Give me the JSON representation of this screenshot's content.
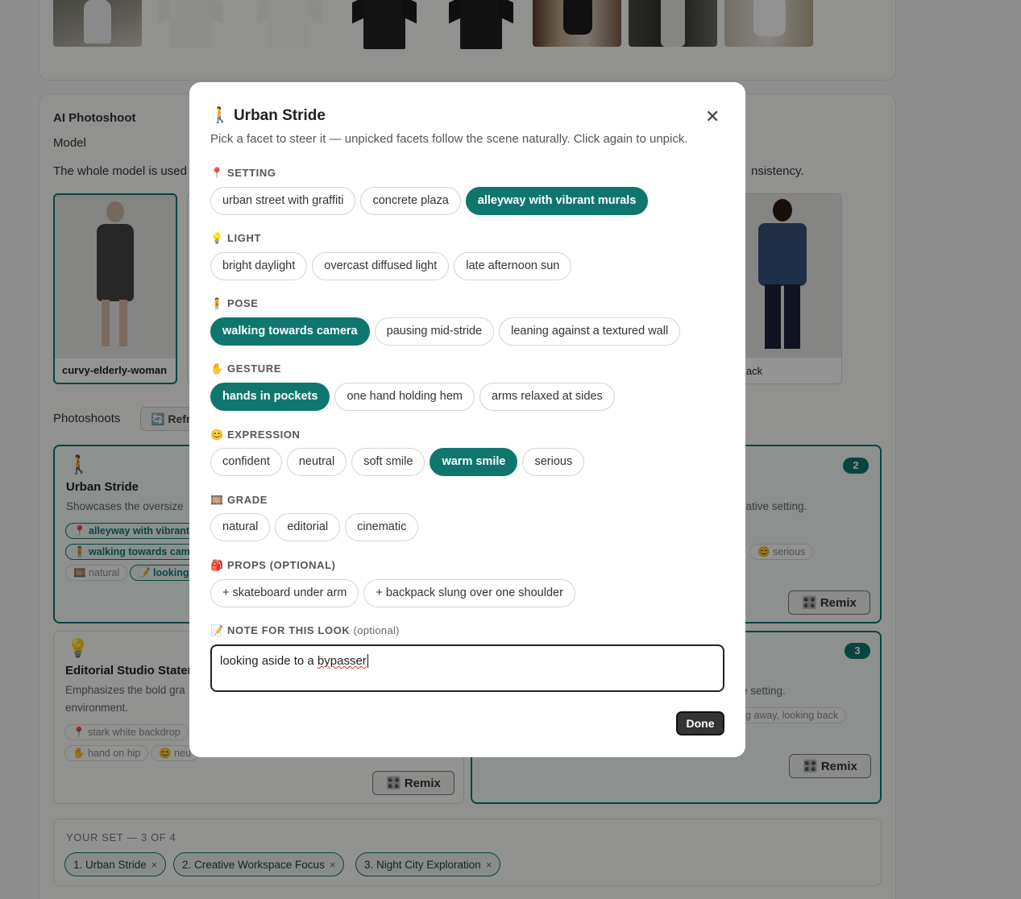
{
  "background": {
    "ai_photoshoot": {
      "heading": "AI Photoshoot",
      "model_label": "Model",
      "desc_left": "The whole model is used",
      "desc_right": "nsistency.",
      "models": [
        {
          "name": "curvy-elderly-woman"
        },
        {
          "name": "lack"
        }
      ]
    },
    "photoshoots": {
      "label": "Photoshoots",
      "refresh_label": "Refr",
      "cards": [
        {
          "emoji": "🚶",
          "title": "Urban Stride",
          "desc": "Showcases the oversize",
          "tags": [
            "📍 alleyway with vibrant",
            "🧍 walking towards came",
            "🎞️ natural",
            "📝 looking"
          ]
        },
        {
          "number": "2",
          "desc": "eative setting.",
          "tags": [
            "😊 serious"
          ],
          "remix_label": "🎛️ Remix"
        },
        {
          "emoji": "💡",
          "title": "Editorial Studio Statem",
          "desc_line1": "Emphasizes the bold gra",
          "desc_line2": "environment.",
          "tags": [
            "📍 stark white backdrop",
            "✋ hand on hip",
            "😊 neu"
          ],
          "remix_label": "🎛️ Remix"
        },
        {
          "number": "3",
          "desc": "e setting.",
          "tags": [
            "ng away, looking back"
          ],
          "remix_label": "🎛️ Remix"
        }
      ]
    },
    "your_set": {
      "label": "YOUR SET — 3 OF 4",
      "items": [
        "1. Urban Stride",
        "2. Creative Workspace Focus",
        "3. Night City Exploration"
      ],
      "remove_glyph": "×"
    }
  },
  "modal": {
    "emoji": "🚶",
    "title": "Urban Stride",
    "close_glyph": "✕",
    "subtitle": "Pick a facet to steer it — unpicked facets follow the scene naturally. Click again to unpick.",
    "sections": [
      {
        "icon": "📍",
        "label": "SETTING",
        "options": [
          "urban street with graffiti",
          "concrete plaza",
          "alleyway with vibrant murals"
        ],
        "selected": 2
      },
      {
        "icon": "💡",
        "label": "LIGHT",
        "options": [
          "bright daylight",
          "overcast diffused light",
          "late afternoon sun"
        ],
        "selected": -1
      },
      {
        "icon": "🧍",
        "label": "POSE",
        "options": [
          "walking towards camera",
          "pausing mid-stride",
          "leaning against a textured wall"
        ],
        "selected": 0
      },
      {
        "icon": "✋",
        "label": "GESTURE",
        "options": [
          "hands in pockets",
          "one hand holding hem",
          "arms relaxed at sides"
        ],
        "selected": 0
      },
      {
        "icon": "😊",
        "label": "EXPRESSION",
        "options": [
          "confident",
          "neutral",
          "soft smile",
          "warm smile",
          "serious"
        ],
        "selected": 3
      },
      {
        "icon": "🎞️",
        "label": "GRADE",
        "options": [
          "natural",
          "editorial",
          "cinematic"
        ],
        "selected": -1
      },
      {
        "icon": "🎒",
        "label": "PROPS (OPTIONAL)",
        "options": [
          "+ skateboard under arm",
          "+ backpack slung over one shoulder"
        ],
        "selected": -1
      }
    ],
    "note": {
      "icon": "📝",
      "label": "NOTE FOR THIS LOOK",
      "optional": "(optional)",
      "value_plain": "looking aside to a ",
      "value_flagged": "bypasser"
    },
    "done_label": "Done"
  },
  "colors": {
    "accent": "#0f766e",
    "overlay": "rgba(0,0,0,0.42)"
  }
}
